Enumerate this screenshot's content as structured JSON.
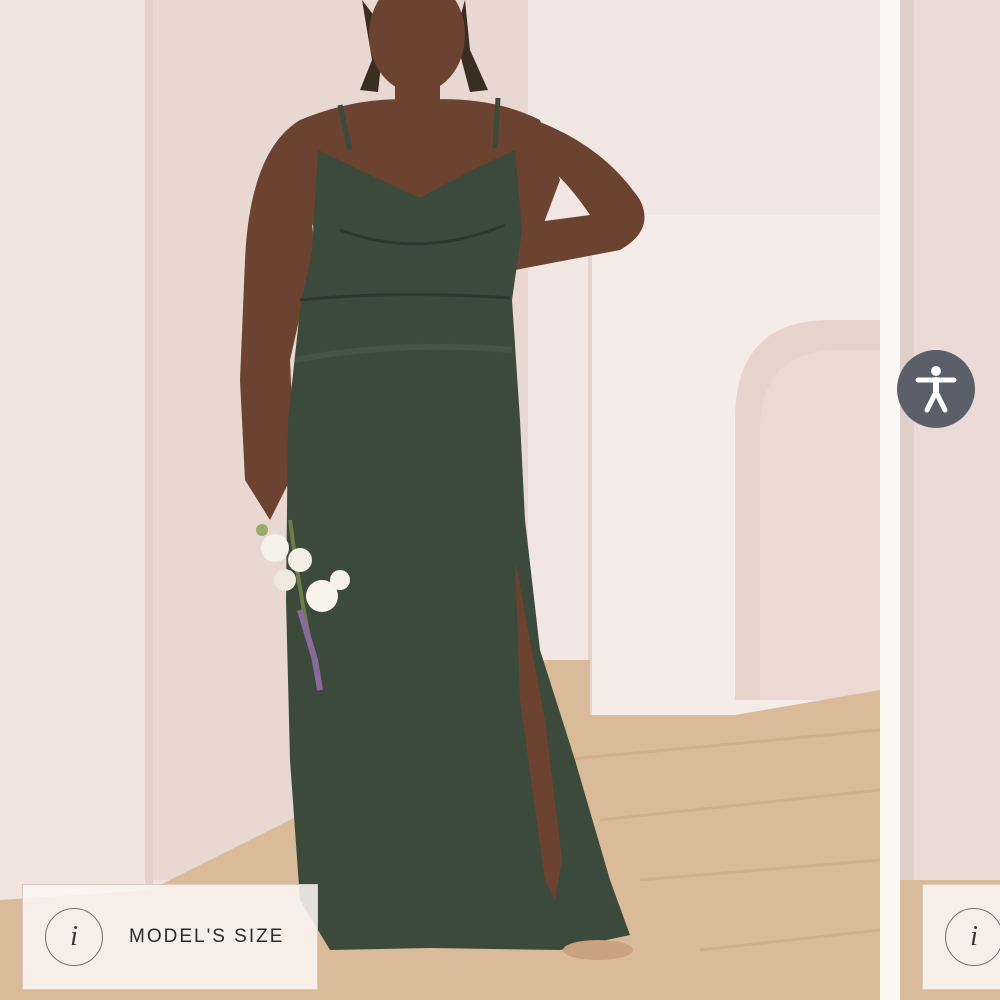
{
  "product_image": {
    "alt": "Model wearing dark green satin slip maxi dress with side slit, holding a bouquet"
  },
  "size_info": {
    "info_icon": "i",
    "label": "MODEL'S SIZE"
  },
  "next_size_info": {
    "info_icon": "i"
  },
  "accessibility": {
    "icon": "accessibility-person-icon"
  },
  "colors": {
    "dress": "#3b4a3a",
    "wall": "#efe1dc",
    "floor": "#d8b896",
    "a11y_button": "#5b5f6a"
  }
}
